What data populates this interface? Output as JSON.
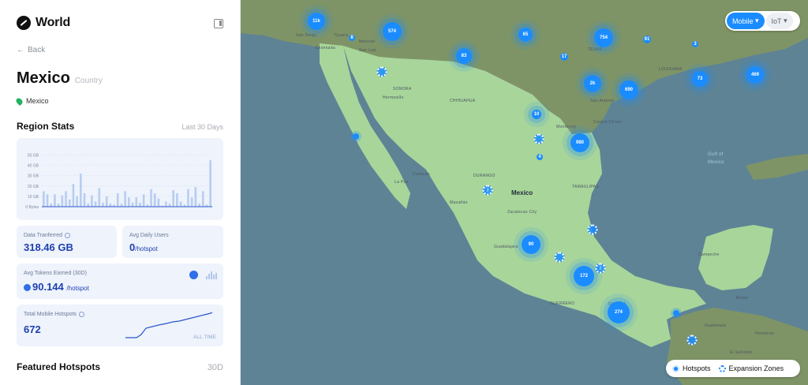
{
  "brand": {
    "name": "World"
  },
  "nav": {
    "back_label": "Back"
  },
  "region": {
    "name": "Mexico",
    "type": "Country",
    "location": "Mexico"
  },
  "region_stats": {
    "title": "Region Stats",
    "period": "Last 30 Days"
  },
  "chart_data": {
    "type": "bar",
    "yticks": [
      "50 GB",
      "40 GB",
      "30 GB",
      "20 GB",
      "10 GB",
      "0 Bytes"
    ],
    "ylim": [
      0,
      55
    ],
    "values": [
      15,
      12,
      3,
      12,
      3,
      11,
      15,
      7,
      22,
      10,
      32,
      13,
      3,
      11,
      5,
      18,
      4,
      10,
      3,
      2,
      13,
      3,
      15,
      9,
      4,
      9,
      4,
      12,
      2,
      17,
      13,
      8,
      1,
      5,
      3,
      16,
      13,
      5,
      2,
      17,
      9,
      19,
      3,
      15,
      2,
      45
    ],
    "color": "#b7cdf1"
  },
  "stats": {
    "data_transferred": {
      "label": "Data Tranferred",
      "value": "318.46 GB"
    },
    "avg_daily_users": {
      "label": "Avg Daily Users",
      "value": "0",
      "unit": "/hotspot"
    },
    "avg_tokens": {
      "label": "Avg Tokens Earned (30D)",
      "value": "90.144",
      "unit": "/hotspot"
    },
    "total_hotspots": {
      "label": "Total Mobile Hotspots",
      "value": "672",
      "footer": "ALL TIME"
    }
  },
  "featured": {
    "title": "Featured Hotspots",
    "period": "30D"
  },
  "network_toggle": {
    "mobile": "Mobile",
    "iot": "IoT"
  },
  "legend": {
    "hotspots": "Hotspots",
    "zones": "Expansion Zones"
  },
  "map": {
    "labels": {
      "country": "Mexico",
      "gulf1": "Gulf of",
      "gulf2": "Mexico",
      "sonora": "SONORA",
      "hermosillo": "Hermosillo",
      "chihuahua": "CHIHUAHUA",
      "culiacan": "Culiacán",
      "durango": "DURANGO",
      "mazatlan": "Mazatlán",
      "zacatecas": "Zacatecas City",
      "guadalajara": "Guadalajara",
      "tamaulipas": "TAMAULIPAS",
      "monterrey": "Monterrey",
      "sanantonio": "San Antonio",
      "lapaz": "La Paz",
      "guerrero": "GUERRERO",
      "oaxaca": "OAXACA",
      "campeche": "Campeche",
      "belize": "Belize",
      "guatemala": "Guatemala",
      "honduras": "Honduras",
      "elsalvador": "El Salvador",
      "sandiego": "San Diego",
      "tijuana": "Tijuana",
      "mexicali": "Mexicali",
      "ensenada": "Ensenada",
      "sanluis": "San Luis",
      "corpus": "Corpus Christi",
      "louisiana": "LOUISIANA",
      "texas": "TEXAS"
    },
    "clusters": [
      "11k",
      "574",
      "8",
      "65",
      "754",
      "91",
      "83",
      "17",
      "2k",
      "690",
      "73",
      "469",
      "10",
      "980",
      "4",
      "90",
      "172",
      "274",
      "3"
    ],
    "zone_labels": [
      "3",
      "2"
    ]
  }
}
